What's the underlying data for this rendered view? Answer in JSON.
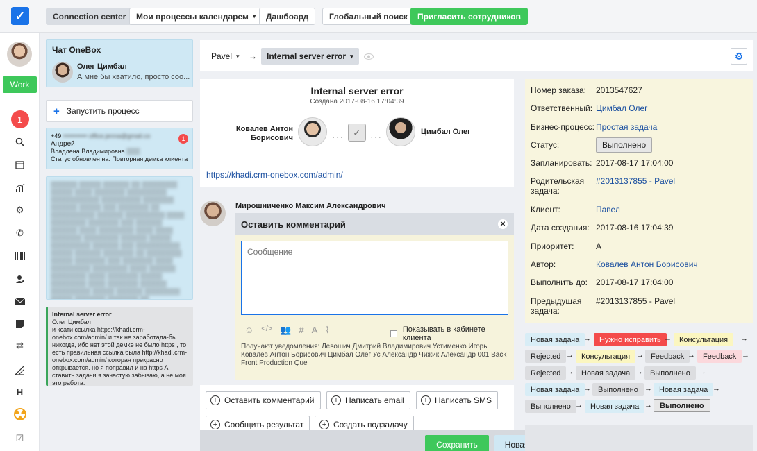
{
  "topbar": {
    "connection_center": "Connection center",
    "my_processes": "Мои процессы календарем",
    "dashboard": "Дашбоард",
    "global_search": "Глобальный поиск",
    "invite": "Пригласить сотрудников"
  },
  "sidebar": {
    "work": "Work",
    "notifications": "1",
    "letter_h": "H"
  },
  "chat": {
    "title": "Чат OneBox",
    "user": "Олег Цимбал",
    "message": "А мне бы хватило, просто соо..."
  },
  "launch_process": "Запустить процесс",
  "process_card": {
    "phone": "+49",
    "name": "Андрей",
    "owner": "Владлена Владимировна",
    "status": "Статус обновлен на: Повторная демка клиента",
    "badge": "1"
  },
  "active_card": {
    "title": "Internal server error",
    "user": "Олег Цимбал",
    "text": "и ксати ссылка https://khadi.crm-onebox.com/admin/ и так не заработада-бы никогда, ибо нет этой демке не было https , то есть правильная ссылка была http://khadi.crm-onebox.com/admin/ которая прекрасно открывается. но я поправил и на https А ставить задачи я зачастую забываю, а не моя это работа."
  },
  "breadcrumb": {
    "first": "Pavel",
    "second": "Internal server error"
  },
  "task": {
    "title": "Internal server error",
    "created": "Создана 2017-08-16 17:04:39",
    "from": "Ковалев Антон Борисович",
    "to": "Цимбал Олег",
    "link": "https://khadi.crm-onebox.com/admin/"
  },
  "comment": {
    "author": "Мирошниченко Максим Александрович",
    "header": "Оставить комментарий",
    "placeholder": "Сообщение",
    "show_client": "Показывать в кабинете клиента",
    "notify": "Получают уведомления: Левошич Дмитрий Владимирович Устименко Игорь Ковалев Антон Борисович Цимбал Олег Ус Александр Чижик Александр 001 Back Front Production Que"
  },
  "actions": {
    "comment": "Оставить комментарий",
    "email": "Написать email",
    "sms": "Написать SMS",
    "result": "Сообщить результат",
    "subtask": "Создать подзадачу"
  },
  "footer": {
    "save": "Сохранить",
    "new_task": "Новая задача"
  },
  "details": {
    "order_label": "Номер заказа:",
    "order": "2013547627",
    "resp_label": "Ответственный:",
    "resp": "Цимбал Олег",
    "bp_label": "Бизнес-процесс:",
    "bp": "Простая задача",
    "status_label": "Статус:",
    "status": "Выполнено",
    "plan_label": "Запланировать:",
    "plan": "2017-08-17 17:04:00",
    "parent_label": "Родительская задача:",
    "parent": "#2013137855 - Pavel",
    "client_label": "Клиент:",
    "client": "Павел",
    "created_label": "Дата создания:",
    "created": "2017-08-16 17:04:39",
    "priority_label": "Приоритет:",
    "priority": "A",
    "author_label": "Автор:",
    "author": "Ковалев Антон Борисович",
    "due_label": "Выполнить до:",
    "due": "2017-08-17 17:04:00",
    "prev_label": "Предыдущая задача:",
    "prev": "#2013137855 - Pavel"
  },
  "flow": [
    "Новая задача",
    "Нужно исправить",
    "Консультация",
    "Rejected",
    "Консультация",
    "Feedback",
    "Feedback",
    "Rejected",
    "Новая задача",
    "Выполнено",
    "Новая задача",
    "Выполнено",
    "Новая задача",
    "Выполнено",
    "Новая задача",
    "Выполнено"
  ],
  "arrow": "→",
  "colors": {
    "accent": "#1a73e8",
    "green": "#3ec85b",
    "red": "#f44b4b"
  }
}
